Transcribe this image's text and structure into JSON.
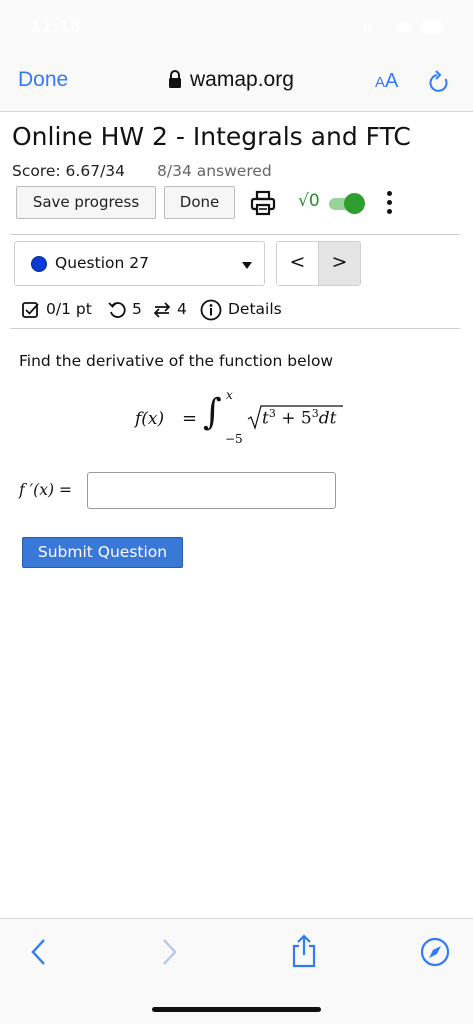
{
  "status_bar": {
    "time": "11:18"
  },
  "browser": {
    "done_label": "Done",
    "url": "wamap.org",
    "aa_small": "A",
    "aa_big": "A"
  },
  "page": {
    "title": "Online HW 2 - Integrals and FTC",
    "score": "Score: 6.67/34",
    "answered": "8/34 answered",
    "buttons": {
      "save": "Save progress",
      "done": "Done"
    },
    "math_toggle_label": "√0"
  },
  "question": {
    "selected": "Question 27",
    "prev": "<",
    "next": ">",
    "points": "0/1 pt",
    "retries": "5",
    "attempts": "4",
    "details": "Details",
    "prompt": "Find the derivative of the function below",
    "formula": {
      "lhs": "f(x)",
      "eq": "=",
      "integral": "∫",
      "upper": "x",
      "lower": "−5",
      "radicand_base1": "t",
      "radicand_exp1": "3",
      "radicand_mid": " + 5",
      "radicand_exp2": "3",
      "differential": "dt"
    },
    "answer_label": "f ′(x) =",
    "answer_value": "",
    "submit_label": "Submit Question"
  },
  "colors": {
    "ios_blue": "#2f7cf6",
    "submit_blue": "#3a78d8",
    "toggle_green": "#2e9e2e",
    "question_dot": "#0b3bd6"
  },
  "icons": [
    "lock-icon",
    "reload-icon",
    "print-icon",
    "more-icon",
    "checkbox-icon",
    "retry-icon",
    "attempts-icon",
    "info-icon",
    "back-icon",
    "forward-icon",
    "share-icon",
    "compass-icon"
  ]
}
